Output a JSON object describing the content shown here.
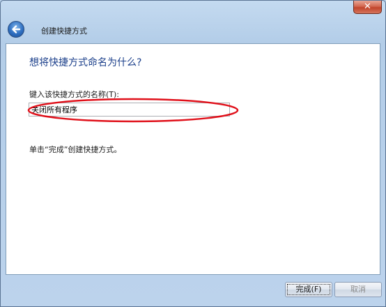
{
  "window": {
    "close_glyph": "✕"
  },
  "nav": {
    "title": "创建快捷方式"
  },
  "content": {
    "heading": "想将快捷方式命名为什么?",
    "name_label": "键入该快捷方式的名称(T):",
    "name_value": "关闭所有程序",
    "hint": "单击“完成”创建快捷方式。"
  },
  "buttons": {
    "finish": "完成(F)",
    "cancel": "取消"
  },
  "colors": {
    "heading": "#1a3e8a",
    "annotation": "#e0101a",
    "close": "#c1442b"
  },
  "icons": {
    "back": "back-arrow-icon",
    "close": "close-icon"
  }
}
